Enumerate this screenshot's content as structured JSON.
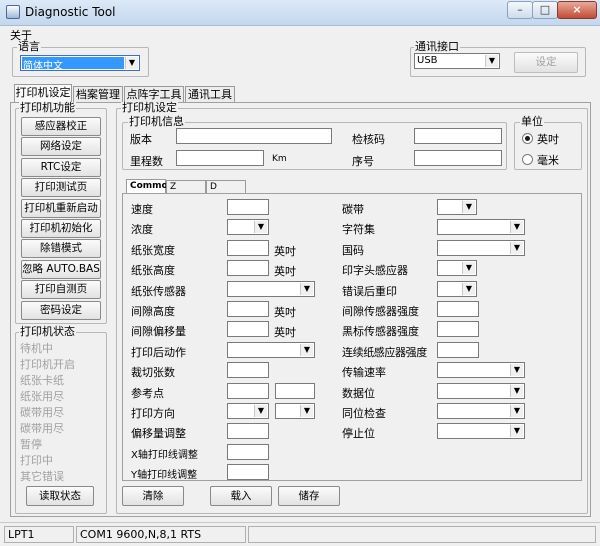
{
  "window": {
    "title": "Diagnostic Tool",
    "minimize": "–",
    "maximize": "□",
    "close": "×"
  },
  "menu": {
    "about": "关于"
  },
  "language": {
    "label": "语言",
    "value": "简体中文"
  },
  "comm": {
    "label": "通讯接口",
    "value": "USB",
    "settings_button": "设定"
  },
  "tabs": [
    "打印机设定",
    "档案管理",
    "点阵字工具",
    "通讯工具"
  ],
  "func": {
    "label": "打印机功能",
    "buttons": [
      "感应器校正",
      "网络设定",
      "RTC设定",
      "打印测试页",
      "打印机重新启动",
      "打印机初始化",
      "除错模式",
      "忽略 AUTO.BAS",
      "打印自测页",
      "密码设定"
    ]
  },
  "status": {
    "label": "打印机状态",
    "items": [
      "待机中",
      "打印机开启",
      "纸张卡纸",
      "纸张用尽",
      "碳带用尽",
      "碳带用尽",
      "暂停",
      "打印中",
      "其它错误"
    ],
    "read_button": "读取状态"
  },
  "settings": {
    "label": "打印机设定"
  },
  "info": {
    "label": "打印机信息",
    "version": "版本",
    "mileage": "里程数",
    "km": "Km",
    "checksum": "检核码",
    "serial": "序号"
  },
  "unit": {
    "label": "单位",
    "inch": "英吋",
    "mm": "毫米"
  },
  "subtabs": [
    "Common",
    "Z",
    "D"
  ],
  "left_fields": {
    "speed": "速度",
    "density": "浓度",
    "paper_width": "纸张宽度",
    "paper_height": "纸张高度",
    "media_sensor": "纸张传感器",
    "gap_height": "间隙高度",
    "gap_offset": "间隙偏移量",
    "post_action": "打印后动作",
    "cut_count": "裁切张数",
    "ref_point": "参考点",
    "direction": "打印方向",
    "offset_adjust": "偏移量调整",
    "x_adjust": "X轴打印线调整",
    "y_adjust": "Y轴打印线调整",
    "inch": "英吋"
  },
  "right_fields": {
    "ribbon": "碳带",
    "charset": "字符集",
    "country": "国码",
    "print_head": "印字头感应器",
    "reprint": "错误后重印",
    "gap_sensor": "间隙传感器强度",
    "bline_sensor": "黑标传感器强度",
    "cont_sensor": "连续纸感应器强度",
    "baud": "传输速率",
    "data_bits": "数据位",
    "parity": "同位检查",
    "stop_bits": "停止位"
  },
  "actions": {
    "clear": "清除",
    "load": "载入",
    "save": "储存"
  },
  "statusbar": {
    "port": "LPT1",
    "com": "COM1 9600,N,8,1 RTS"
  }
}
